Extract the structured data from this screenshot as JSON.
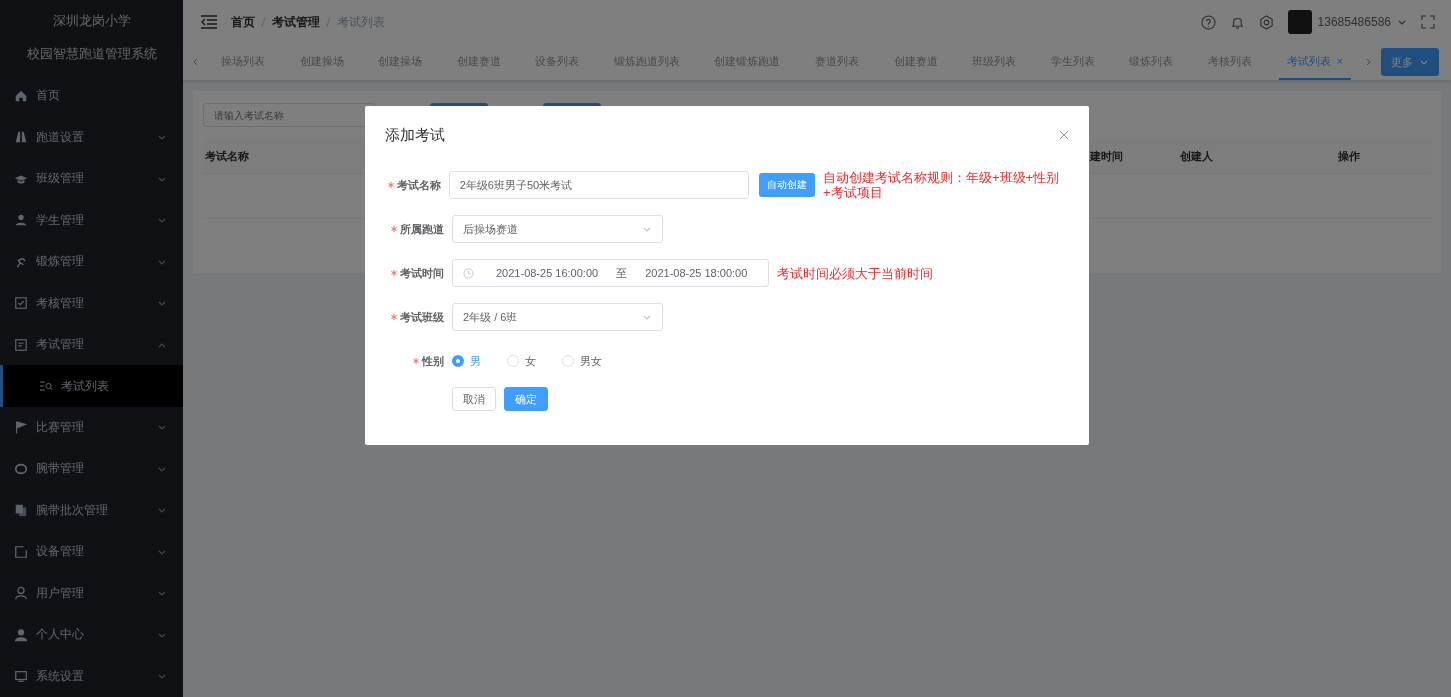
{
  "sidebar": {
    "school": "深圳龙岗小学",
    "system": "校园智慧跑道管理系统",
    "items": [
      {
        "kind": "link",
        "label": "首页"
      },
      {
        "kind": "group",
        "label": "跑道设置",
        "expanded": false
      },
      {
        "kind": "group",
        "label": "班级管理",
        "expanded": false
      },
      {
        "kind": "group",
        "label": "学生管理",
        "expanded": false
      },
      {
        "kind": "group",
        "label": "锻炼管理",
        "expanded": false
      },
      {
        "kind": "group",
        "label": "考核管理",
        "expanded": false
      },
      {
        "kind": "group",
        "label": "考试管理",
        "expanded": true,
        "children": [
          {
            "label": "考试列表",
            "selected": true
          }
        ]
      },
      {
        "kind": "group",
        "label": "比赛管理",
        "expanded": false
      },
      {
        "kind": "group",
        "label": "腕带管理",
        "expanded": false
      },
      {
        "kind": "group",
        "label": "腕带批次管理",
        "expanded": false
      },
      {
        "kind": "group",
        "label": "设备管理",
        "expanded": false
      },
      {
        "kind": "group",
        "label": "用户管理",
        "expanded": false
      },
      {
        "kind": "group",
        "label": "个人中心",
        "expanded": false
      },
      {
        "kind": "group",
        "label": "系统设置",
        "expanded": false
      }
    ]
  },
  "header": {
    "breadcrumb": [
      "首页",
      "考试管理",
      "考试列表"
    ],
    "user": "13685486586"
  },
  "tabs": {
    "items": [
      {
        "label": "操场列表",
        "selected": false
      },
      {
        "label": "创建操场",
        "selected": false
      },
      {
        "label": "创建操场",
        "selected": false
      },
      {
        "label": "创建赛道",
        "selected": false
      },
      {
        "label": "设备列表",
        "selected": false
      },
      {
        "label": "锻炼跑道列表",
        "selected": false
      },
      {
        "label": "创建锻炼跑道",
        "selected": false
      },
      {
        "label": "赛道列表",
        "selected": false
      },
      {
        "label": "创建赛道",
        "selected": false
      },
      {
        "label": "班级列表",
        "selected": false
      },
      {
        "label": "学生列表",
        "selected": false
      },
      {
        "label": "锻炼列表",
        "selected": false
      },
      {
        "label": "考核列表",
        "selected": false
      },
      {
        "label": "考试列表",
        "selected": true,
        "close": "×"
      }
    ],
    "more": "更多"
  },
  "content": {
    "search": {
      "placeholder": "请输入考试名称"
    },
    "table": {
      "columns": [
        "考试名称",
        "建时间",
        "创建人",
        "操作"
      ]
    }
  },
  "dialog": {
    "title": "添加考试",
    "fields": [
      {
        "kind": "text",
        "label": "考试名称",
        "required": true,
        "value": "2年级6班男子50米考试",
        "button": "自动创建",
        "note": "自动创建考试名称规则：年级+班级+性别+考试项目"
      },
      {
        "kind": "select",
        "label": "所属跑道",
        "required": true,
        "value": "后操场赛道"
      },
      {
        "kind": "daterange",
        "label": "考试时间",
        "required": true,
        "start": "2021-08-25 16:00:00",
        "separator": "至",
        "end": "2021-08-25 18:00:00",
        "note": "考试时间必须大于当前时间"
      },
      {
        "kind": "select",
        "label": "考试班级",
        "required": true,
        "value": "2年级 / 6班"
      },
      {
        "kind": "radio",
        "label": "性别",
        "required": true,
        "options": [
          {
            "label": "男",
            "selected": true
          },
          {
            "label": "女",
            "selected": false
          },
          {
            "label": "男女",
            "selected": false
          }
        ]
      }
    ],
    "buttons": [
      {
        "kind": "default",
        "label": "取消"
      },
      {
        "kind": "primary",
        "label": "确定"
      }
    ]
  }
}
